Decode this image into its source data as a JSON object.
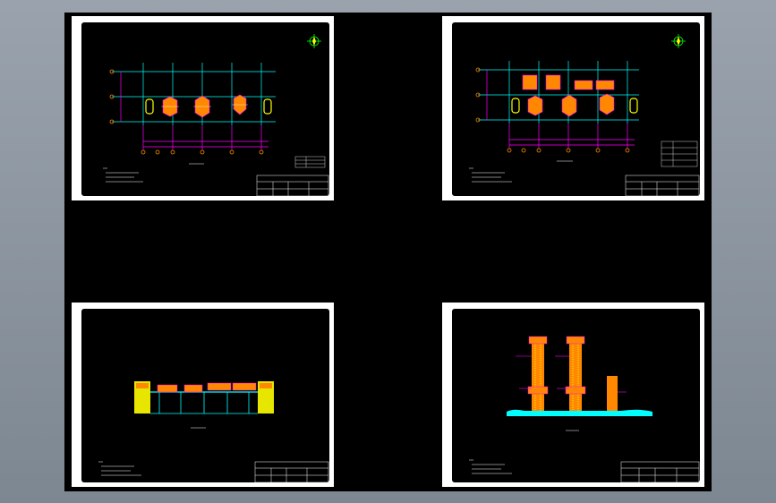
{
  "viewport": {
    "title": ""
  },
  "sheets": [
    {
      "id": "sheet-1",
      "kind": "plan",
      "notes_label": "",
      "title_label": ""
    },
    {
      "id": "sheet-2",
      "kind": "plan-detail",
      "notes_label": "",
      "title_label": ""
    },
    {
      "id": "sheet-3",
      "kind": "elevation",
      "notes_label": "",
      "title_label": ""
    },
    {
      "id": "sheet-4",
      "kind": "section",
      "notes_label": "",
      "title_label": ""
    }
  ],
  "colors": {
    "background": "#000000",
    "frame": "#ffffff",
    "grid": "#00ffff",
    "axis": "#ff00ff",
    "dim": "#ff00ff",
    "element_fill": "#ff8800",
    "element_edge": "#ffff00",
    "compass": "#00ff00",
    "ground": "#00ffff"
  },
  "icons": {
    "compass": "north-arrow-icon"
  }
}
